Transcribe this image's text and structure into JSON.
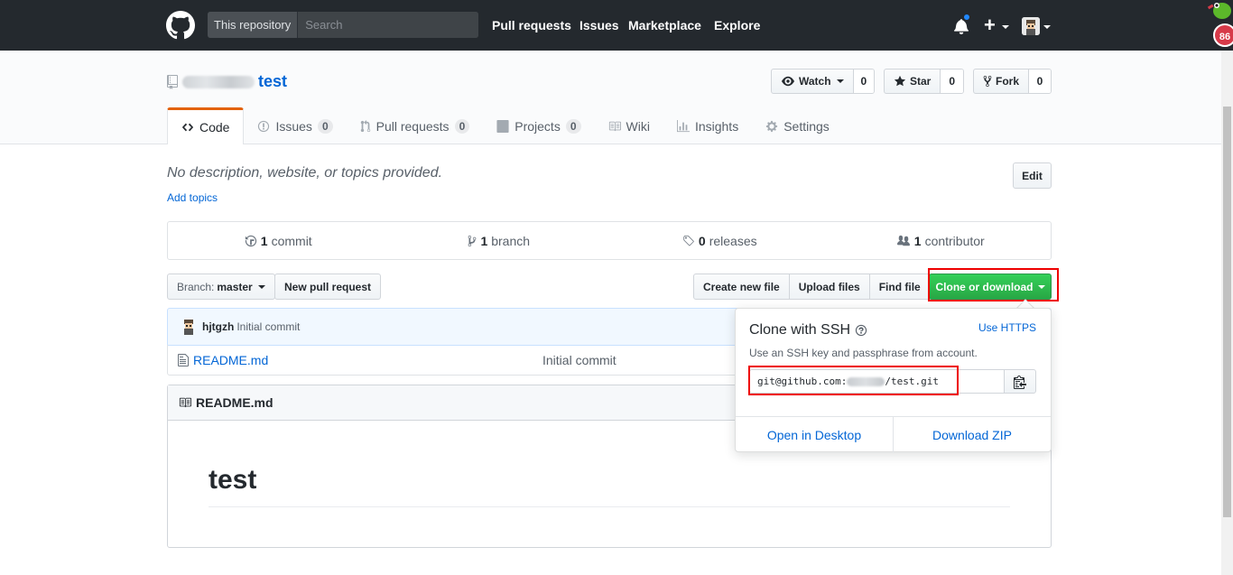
{
  "header": {
    "search_scope": "This repository",
    "search_placeholder": "Search",
    "nav": [
      "Pull requests",
      "Issues",
      "Marketplace",
      "Explore"
    ],
    "notification_badge": "86"
  },
  "repo": {
    "name": "test",
    "watch_label": "Watch",
    "watch_count": "0",
    "star_label": "Star",
    "star_count": "0",
    "fork_label": "Fork",
    "fork_count": "0"
  },
  "tabs": [
    {
      "label": "Code",
      "count": null,
      "icon": "code-icon"
    },
    {
      "label": "Issues",
      "count": "0",
      "icon": "issue-icon"
    },
    {
      "label": "Pull requests",
      "count": "0",
      "icon": "pull-request-icon"
    },
    {
      "label": "Projects",
      "count": "0",
      "icon": "project-icon"
    },
    {
      "label": "Wiki",
      "count": null,
      "icon": "book-icon"
    },
    {
      "label": "Insights",
      "count": null,
      "icon": "graph-icon"
    },
    {
      "label": "Settings",
      "count": null,
      "icon": "gear-icon"
    }
  ],
  "description": {
    "text": "No description, website, or topics provided.",
    "add_topics": "Add topics",
    "edit_label": "Edit"
  },
  "summary": {
    "commits_count": "1",
    "commits_label": "commit",
    "branches_count": "1",
    "branches_label": "branch",
    "releases_count": "0",
    "releases_label": "releases",
    "contributors_count": "1",
    "contributors_label": "contributor"
  },
  "file_nav": {
    "branch_prefix": "Branch:",
    "branch_name": "master",
    "new_pr": "New pull request",
    "create_file": "Create new file",
    "upload_files": "Upload files",
    "find_file": "Find file",
    "clone_download": "Clone or download"
  },
  "commit": {
    "author": "hjtgzh",
    "message": "Initial commit"
  },
  "files": [
    {
      "name": "README.md",
      "message": "Initial commit"
    }
  ],
  "readme": {
    "filename": "README.md",
    "heading": "test"
  },
  "clone_popup": {
    "title": "Clone with SSH",
    "use_https": "Use HTTPS",
    "subtitle": "Use an SSH key and passphrase from account.",
    "url_prefix": "git@github.com:",
    "url_suffix": "/test.git",
    "open_desktop": "Open in Desktop",
    "download_zip": "Download ZIP"
  },
  "colors": {
    "header_bg": "#24292e",
    "link": "#0366d6",
    "clone_green": "#28a745",
    "tab_accent": "#e36209",
    "highlight_red": "#e00000"
  }
}
